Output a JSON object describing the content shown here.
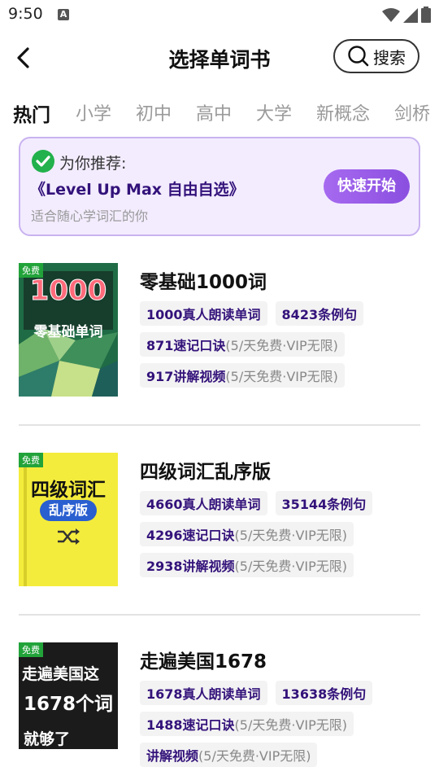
{
  "status": {
    "time": "9:50"
  },
  "header": {
    "title": "选择单词书",
    "search_label": "搜索"
  },
  "tabs": [
    "热门",
    "小学",
    "初中",
    "高中",
    "大学",
    "新概念",
    "剑桥"
  ],
  "recommend": {
    "label": "为你推荐:",
    "book": "《Level Up Max 自由自选》",
    "desc": "适合随心学词汇的你",
    "start_label": "快速开始"
  },
  "books": [
    {
      "title": "零基础1000词",
      "free_badge": "免费",
      "cover": {
        "line1": "1000",
        "line2": "零基础单词"
      },
      "words_count": "1000",
      "words_label": "真人朗读单词",
      "examples_count": "8423",
      "examples_label": "条例句",
      "mnemonic_count": "871",
      "mnemonic_label": "速记口诀",
      "mnemonic_note": "(5/天免费·VIP无限)",
      "video_count": "917",
      "video_label": "讲解视频",
      "video_note": "(5/天免费·VIP无限)"
    },
    {
      "title": "四级词汇乱序版",
      "free_badge": "免费",
      "cover": {
        "line1": "四级词汇",
        "line2": "乱序版"
      },
      "words_count": "4660",
      "words_label": "真人朗读单词",
      "examples_count": "35144",
      "examples_label": "条例句",
      "mnemonic_count": "4296",
      "mnemonic_label": "速记口诀",
      "mnemonic_note": "(5/天免费·VIP无限)",
      "video_count": "2938",
      "video_label": "讲解视频",
      "video_note": "(5/天免费·VIP无限)"
    },
    {
      "title": "走遍美国1678",
      "free_badge": "免费",
      "cover": {
        "line1": "走遍美国这",
        "line2": "1678个词",
        "line3": "就够了"
      },
      "words_count": "1678",
      "words_label": "真人朗读单词",
      "examples_count": "13638",
      "examples_label": "条例句",
      "mnemonic_count": "1488",
      "mnemonic_label": "速记口诀",
      "mnemonic_note": "(5/天免费·VIP无限)",
      "video_count": "",
      "video_label": "讲解视频",
      "video_note": "(5/天免费·VIP无限)"
    }
  ],
  "colors": {
    "accent": "#8b4fe0",
    "highlight_text": "#33127a",
    "free_badge": "#22a33a"
  }
}
